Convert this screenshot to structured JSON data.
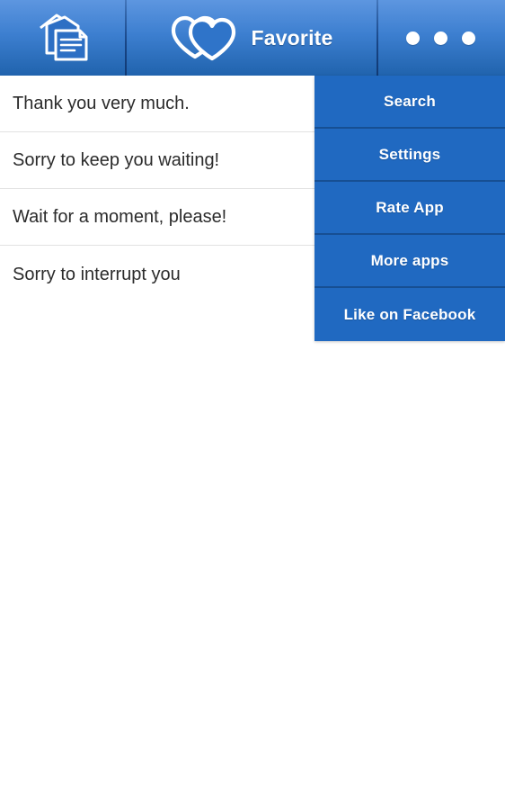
{
  "header": {
    "documents_icon": "documents-stack-icon",
    "hearts_icon": "two-hearts-icon",
    "title": "Favorite",
    "overflow_icon": "three-dots-overflow-icon",
    "gradient_top_color": "#5d96e0",
    "gradient_bottom_color": "#2063ad",
    "divider_color": "#10376f",
    "text_color": "#ffffff"
  },
  "list": {
    "items": [
      {
        "label": "Thank you very much."
      },
      {
        "label": "Sorry to keep you waiting!"
      },
      {
        "label": "Wait for a moment, please!"
      },
      {
        "label": "Sorry to interrupt you"
      }
    ],
    "background_color": "#ffffff",
    "text_color": "#2b2b2b",
    "separator_color": "#e2e2e2"
  },
  "overflow_menu": {
    "items": [
      {
        "label": "Search"
      },
      {
        "label": "Settings"
      },
      {
        "label": "Rate App"
      },
      {
        "label": "More apps"
      },
      {
        "label": "Like on Facebook"
      }
    ],
    "background_color": "#2069c1",
    "separator_color": "#164f93",
    "text_color": "#ffffff"
  },
  "page": {
    "background_color": "#ffffff"
  }
}
